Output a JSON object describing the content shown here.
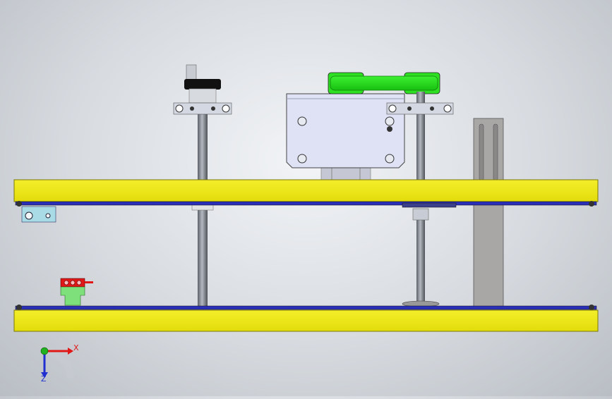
{
  "viewport": {
    "background_top": "#f2f4f7",
    "background_bottom": "#b9bec4"
  },
  "colors": {
    "plate": "#f0ea12",
    "plate_edge": "#7a7808",
    "rail": "#2a2fb8",
    "belt": "#27e81c",
    "housing": "#dfe2f5",
    "shaft": "#8a8e96",
    "clamp": "#c8ccd8",
    "knob": "#111111",
    "upright": "#a9a6a6",
    "sensor_red": "#e01818",
    "sensor_green": "#7de07a",
    "bracket": "#a8dbe6",
    "axis_x": "#e01818",
    "axis_y": "#20b020",
    "axis_z": "#2030d0"
  },
  "triad": {
    "x_label": "X",
    "z_label": "Z"
  }
}
